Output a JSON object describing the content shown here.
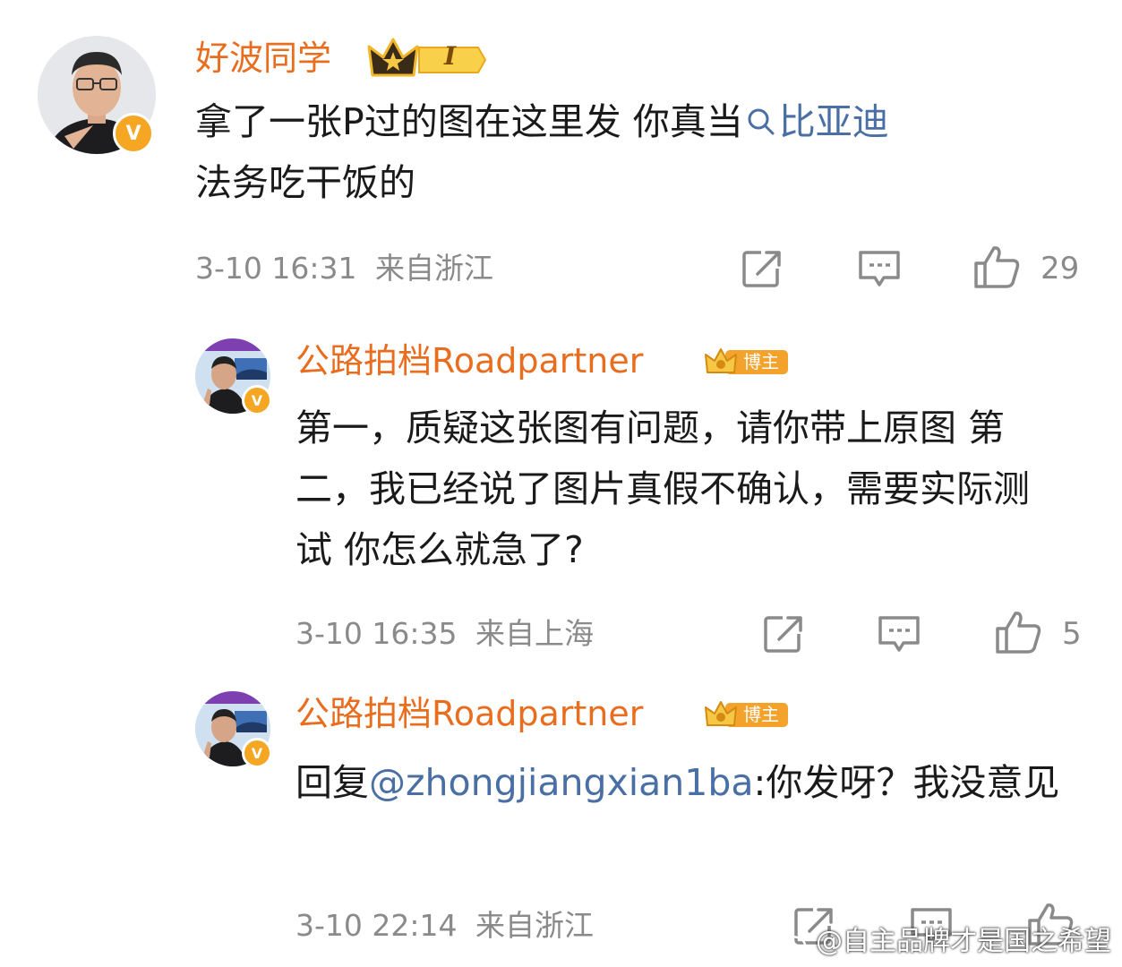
{
  "comments": [
    {
      "user": "好波同学",
      "badge_level": "I",
      "text_before_link": "拿了一张P过的图在这里发 你真当",
      "search_link": "比亚迪",
      "text_after_link": "法务吃干饭的",
      "timestamp": "3-10 16:31",
      "location": "来自浙江",
      "likes": "29"
    },
    {
      "user": "公路拍档Roadpartner",
      "badge_label": "博主",
      "text": "第一，质疑这张图有问题，请你带上原图 第二，我已经说了图片真假不确认，需要实际测试 你怎么就急了?",
      "timestamp": "3-10 16:35",
      "location": "来自上海",
      "likes": "5"
    },
    {
      "user": "公路拍档Roadpartner",
      "badge_label": "博主",
      "reply_prefix": "回复",
      "mention": "@zhongjiangxian1ba",
      "reply_text": ":你发呀？我没意见",
      "timestamp": "3-10 22:14",
      "location": "来自浙江"
    }
  ],
  "watermark": "@自主品牌才是国之希望",
  "colors": {
    "username": "#e96d1f",
    "link": "#4a6fa5",
    "meta": "#8a8a8a",
    "verified_badge": "#f5a623"
  },
  "icons": [
    "repost-icon",
    "comment-icon",
    "like-icon",
    "search-icon",
    "crown-icon",
    "verified-v-icon",
    "weibo-logo-icon"
  ]
}
